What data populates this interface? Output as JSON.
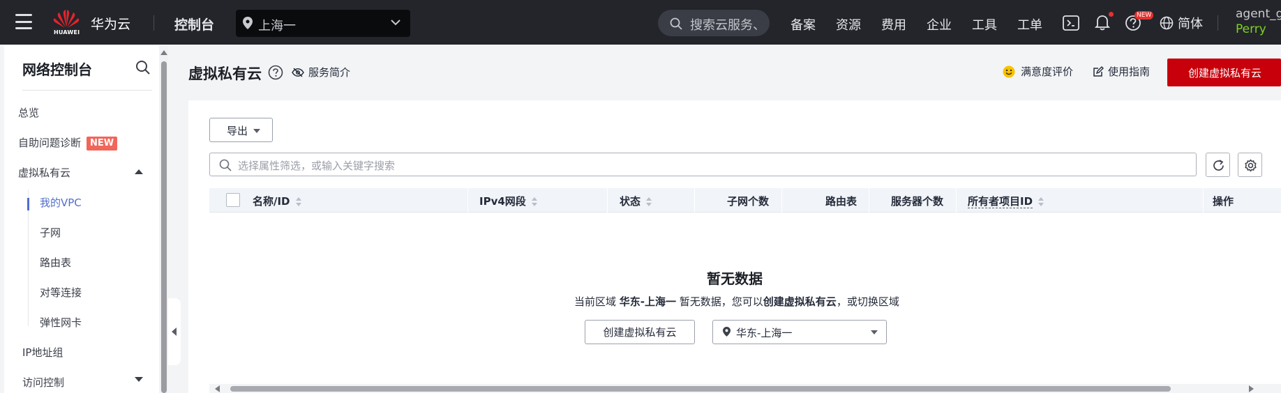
{
  "topbar": {
    "brand_logo_text": "HUAWEI",
    "brand": "华为云",
    "console": "控制台",
    "region": "上海一",
    "search_placeholder": "搜索云服务、",
    "nav": [
      "备案",
      "资源",
      "费用",
      "企业",
      "工具",
      "工单"
    ],
    "new_badge": "NEW",
    "language": "简体",
    "user_name": "agent_g",
    "user_sub": "Perry"
  },
  "sidebar": {
    "title": "网络控制台",
    "items": [
      {
        "label": "总览"
      },
      {
        "label": "自助问题诊断",
        "badge": "NEW"
      },
      {
        "label": "虚拟私有云"
      },
      {
        "label": "我的VPC"
      },
      {
        "label": "子网"
      },
      {
        "label": "路由表"
      },
      {
        "label": "对等连接"
      },
      {
        "label": "弹性网卡"
      },
      {
        "label": "IP地址组"
      },
      {
        "label": "访问控制"
      }
    ]
  },
  "header": {
    "title": "虚拟私有云",
    "intro": "服务简介",
    "rating": "满意度评价",
    "guide": "使用指南",
    "create_button": "创建虚拟私有云"
  },
  "toolbar": {
    "export": "导出",
    "filter_placeholder": "选择属性筛选，或输入关键字搜索"
  },
  "table": {
    "columns": [
      "名称/ID",
      "IPv4网段",
      "状态",
      "子网个数",
      "路由表",
      "服务器个数",
      "所有者项目ID",
      "操作"
    ]
  },
  "empty": {
    "title": "暂无数据",
    "desc_prefix": "当前区域 ",
    "desc_region": "华东-上海一",
    "desc_mid": " 暂无数据，您可以",
    "desc_action": "创建虚拟私有云",
    "desc_suffix": "，或切换区域",
    "create_button": "创建虚拟私有云",
    "region_select": "华东-上海一"
  },
  "colors": {
    "topbar_bg": "#23252b",
    "accent_red": "#c7000b",
    "active_blue": "#526ecc",
    "new_badge": "#f2655a",
    "user_green": "#7ed321"
  }
}
